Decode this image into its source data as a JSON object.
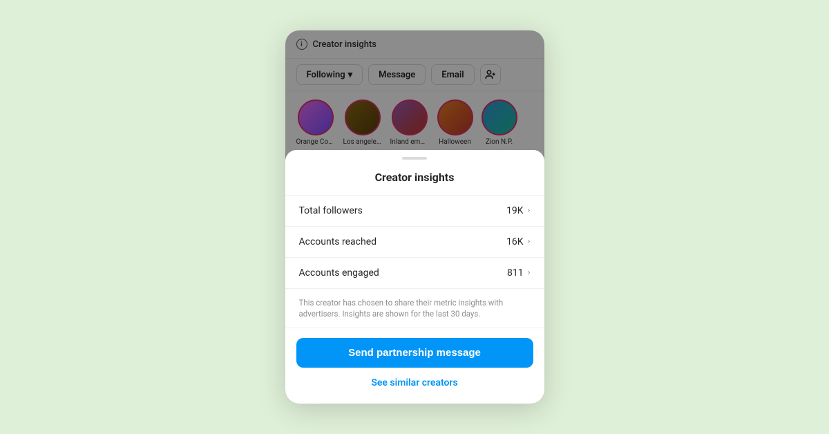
{
  "bg": {
    "header_title": "Creator insights",
    "info_label": "ⓘ",
    "buttons": [
      "Following",
      "Message",
      "Email"
    ],
    "following_label": "Following",
    "message_label": "Message",
    "email_label": "Email",
    "stories": [
      {
        "label": "Orange Cou...",
        "type": "orange"
      },
      {
        "label": "Los angeles...",
        "type": "brown"
      },
      {
        "label": "Inland empire",
        "type": "purple"
      },
      {
        "label": "Halloween",
        "type": "dark-orange"
      },
      {
        "label": "Zion N.P.",
        "type": "blue"
      }
    ]
  },
  "sheet": {
    "title": "Creator insights",
    "rows": [
      {
        "label": "Total followers",
        "value": "19K"
      },
      {
        "label": "Accounts reached",
        "value": "16K"
      },
      {
        "label": "Accounts engaged",
        "value": "811"
      }
    ],
    "note": "This creator has chosen to share their metric insights with advertisers. Insights are shown for the last 30 days.",
    "send_btn": "Send partnership message",
    "see_similar": "See similar creators"
  }
}
